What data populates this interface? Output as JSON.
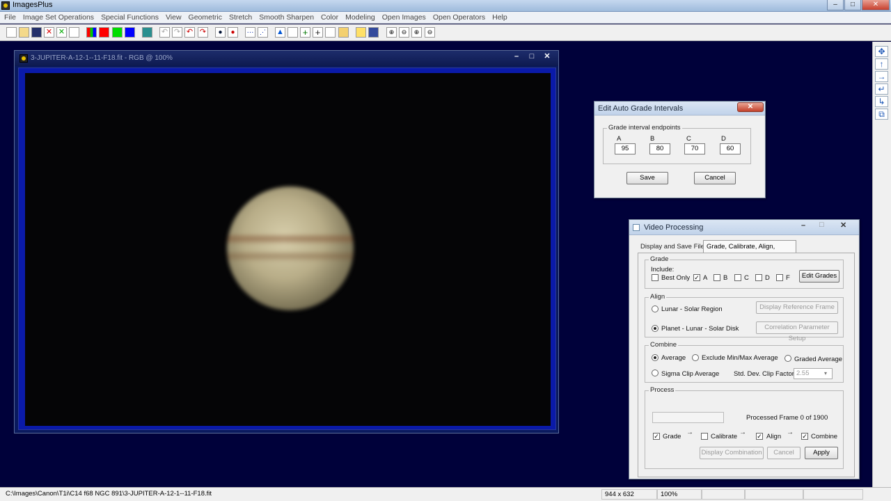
{
  "app": {
    "title": "ImagesPlus"
  },
  "menu": [
    "File",
    "Image Set Operations",
    "Special Functions",
    "View",
    "Geometric",
    "Stretch",
    "Smooth Sharpen",
    "Color",
    "Modeling",
    "Open Images",
    "Open Operators",
    "Help"
  ],
  "image_window": {
    "title": "3-JUPITER-A-12-1--11-F18.fit - RGB @ 100%"
  },
  "grade_dialog": {
    "title": "Edit Auto Grade Intervals",
    "group_label": "Grade interval endpoints",
    "fields": [
      {
        "label": "A",
        "value": "95"
      },
      {
        "label": "B",
        "value": "80"
      },
      {
        "label": "C",
        "value": "70"
      },
      {
        "label": "D",
        "value": "60"
      }
    ],
    "save": "Save",
    "cancel": "Cancel"
  },
  "video": {
    "title": "Video Processing",
    "tabs": [
      "Display and Save Files",
      "Grade, Calibrate, Align, Combine"
    ],
    "grade": {
      "label": "Grade",
      "include": "Include:",
      "best_only": "Best Only",
      "grades": [
        "A",
        "B",
        "C",
        "D",
        "F"
      ],
      "edit_button": "Edit Grades"
    },
    "align": {
      "label": "Align",
      "lunar": "Lunar - Solar Region",
      "planet": "Planet - Lunar - Solar Disk",
      "display_ref": "Display Reference Frame",
      "corr_setup": "Correlation Parameter Setup"
    },
    "combine": {
      "label": "Combine",
      "average": "Average",
      "exclude": "Exclude Min/Max Average",
      "graded": "Graded Average",
      "sigma": "Sigma Clip Average",
      "std_label": "Std. Dev. Clip Factor:",
      "std_value": "2.55"
    },
    "process": {
      "label": "Process",
      "status": "Processed Frame 0 of 1900",
      "grade": "Grade",
      "calibrate": "Calibrate",
      "align": "Align",
      "combine": "Combine",
      "display_combination": "Display Combination",
      "cancel": "Cancel",
      "apply": "Apply"
    }
  },
  "statusbar": {
    "path": "C:\\Images\\Canon\\T1i\\C14 f68 NGC 891\\3-JUPITER-A-12-1--11-F18.fit",
    "size": "944 x 632",
    "zoom": "100%"
  }
}
